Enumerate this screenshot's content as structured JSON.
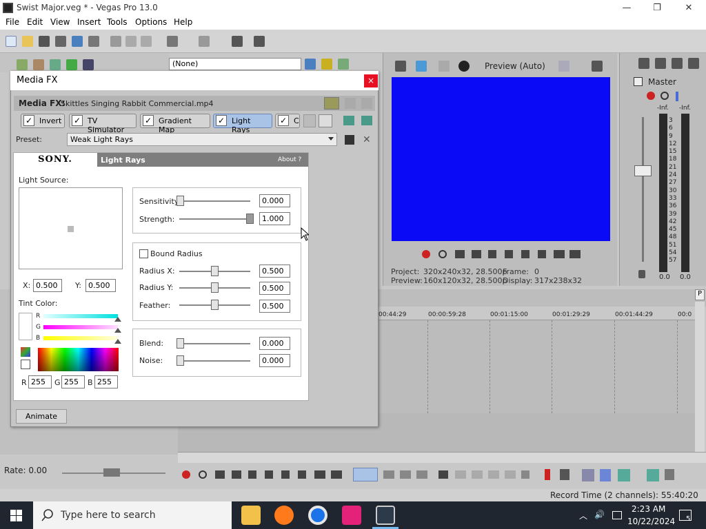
{
  "window": {
    "title": "Swist Major.veg * - Vegas Pro 13.0",
    "minimize": "—",
    "maximize": "❐",
    "close": "✕"
  },
  "menu": [
    "File",
    "Edit",
    "View",
    "Insert",
    "Tools",
    "Options",
    "Help"
  ],
  "toolbar": {
    "selector_value": "(None)"
  },
  "preview": {
    "mode_label": "Preview (Auto)",
    "project_label": "Project:",
    "project_value": "320x240x32, 28.500p",
    "frame_label": "Frame:",
    "frame_value": "0",
    "preview_label": "Preview:",
    "preview_value": "160x120x32, 28.500p",
    "display_label": "Display:",
    "display_value": "317x238x32",
    "screen_color": "#0a0af6"
  },
  "master": {
    "title": "Master",
    "inf_left": "-Inf.",
    "inf_right": "-Inf.",
    "scale": [
      "3",
      "6",
      "9",
      "12",
      "15",
      "18",
      "21",
      "24",
      "27",
      "30",
      "33",
      "36",
      "39",
      "42",
      "45",
      "48",
      "51",
      "54",
      "57"
    ],
    "val_left": "0.0",
    "val_right": "0.0"
  },
  "timeline": {
    "ticks": [
      "00:44:29",
      "00:00:59:28",
      "00:01:15:00",
      "00:01:29:29",
      "00:01:44:29",
      "00:0"
    ]
  },
  "transport": {
    "rate": "Rate: 0.00"
  },
  "status": {
    "record_time": "Record Time (2 channels): 55:40:20"
  },
  "taskbar": {
    "search_placeholder": "Type here to search",
    "time": "2:23 AM",
    "date": "10/22/2024",
    "notif_count": "5"
  },
  "dialog": {
    "title": "Media FX",
    "close": "×",
    "mediafx_label": "Media FX:",
    "media_name": "Skittles Singing Rabbit Commercial.mp4",
    "fx_chain": [
      {
        "label": "Invert",
        "active": false
      },
      {
        "label": "TV Simulator",
        "active": false
      },
      {
        "label": "Gradient Map",
        "active": false
      },
      {
        "label": "Light Rays",
        "active": true
      },
      {
        "label": "C",
        "active": false
      }
    ],
    "check": "✓",
    "preset_label": "Preset:",
    "preset_value": "Weak Light Rays",
    "brand": "SONY.",
    "plugin_title": "Light Rays",
    "about": "About  ?",
    "light_source_label": "Light Source:",
    "x_label": "X:",
    "x_value": "0.500",
    "y_label": "Y:",
    "y_value": "0.500",
    "tint_label": "Tint Color:",
    "r_label": "R",
    "g_label": "G",
    "b_label": "B",
    "r_value": "255",
    "g_value": "255",
    "b_value": "255",
    "sensitivity_label": "Sensitivity:",
    "sensitivity_value": "0.000",
    "strength_label": "Strength:",
    "strength_value": "1.000",
    "bound_radius_label": "Bound Radius",
    "radius_x_label": "Radius X:",
    "radius_x_value": "0.500",
    "radius_y_label": "Radius Y:",
    "radius_y_value": "0.500",
    "feather_label": "Feather:",
    "feather_value": "0.500",
    "blend_label": "Blend:",
    "blend_value": "0.000",
    "noise_label": "Noise:",
    "noise_value": "0.000",
    "animate_label": "Animate"
  }
}
